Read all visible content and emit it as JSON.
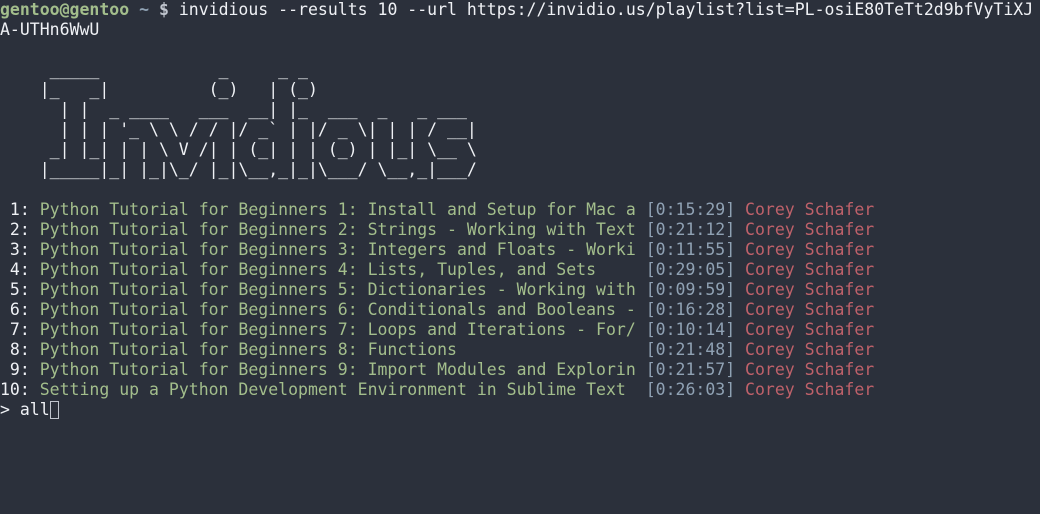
{
  "prompt": {
    "user_host": "gentoo@gentoo",
    "dir": "~",
    "symbol": "$",
    "command_line1": "invidious --results 10 --url https://invidio.us/playlist?list=PL-osiE80TeTt2d9bfVyTiXJ",
    "command_line2": "A-UTHn6WwU"
  },
  "banner": [
    "     _____            _     _ _",
    "    |_   _|          (_)   | (_)",
    "      | |  _ ____   ___  __| |_  ___  _   _ ___",
    "      | | | '_ \\ \\ / / |/ _` | |/ _ \\| | | / __|",
    "     _| |_| | | \\ V /| | (_| | | (_) | |_| \\__ \\",
    "    |_____|_| |_|\\_/ |_|\\__,_|_|\\___/ \\__,_|___/"
  ],
  "results": [
    {
      "index": " 1:",
      "title": " Python Tutorial for Beginners 1: Install and Setup for Mac a ",
      "duration": "[0:15:29]",
      "author": " Corey Schafer"
    },
    {
      "index": " 2:",
      "title": " Python Tutorial for Beginners 2: Strings - Working with Text ",
      "duration": "[0:21:12]",
      "author": " Corey Schafer"
    },
    {
      "index": " 3:",
      "title": " Python Tutorial for Beginners 3: Integers and Floats - Worki ",
      "duration": "[0:11:55]",
      "author": " Corey Schafer"
    },
    {
      "index": " 4:",
      "title": " Python Tutorial for Beginners 4: Lists, Tuples, and Sets     ",
      "duration": "[0:29:05]",
      "author": " Corey Schafer"
    },
    {
      "index": " 5:",
      "title": " Python Tutorial for Beginners 5: Dictionaries - Working with ",
      "duration": "[0:09:59]",
      "author": " Corey Schafer"
    },
    {
      "index": " 6:",
      "title": " Python Tutorial for Beginners 6: Conditionals and Booleans - ",
      "duration": "[0:16:28]",
      "author": " Corey Schafer"
    },
    {
      "index": " 7:",
      "title": " Python Tutorial for Beginners 7: Loops and Iterations - For/ ",
      "duration": "[0:10:14]",
      "author": " Corey Schafer"
    },
    {
      "index": " 8:",
      "title": " Python Tutorial for Beginners 8: Functions                   ",
      "duration": "[0:21:48]",
      "author": " Corey Schafer"
    },
    {
      "index": " 9:",
      "title": " Python Tutorial for Beginners 9: Import Modules and Explorin ",
      "duration": "[0:21:57]",
      "author": " Corey Schafer"
    },
    {
      "index": "10:",
      "title": " Setting up a Python Development Environment in Sublime Text  ",
      "duration": "[0:26:03]",
      "author": " Corey Schafer"
    }
  ],
  "input": {
    "prompt": "> ",
    "value": "all"
  },
  "colors": {
    "background": "#2b303b",
    "title": "#a3be8c",
    "duration": "#8fa1b3",
    "author": "#bf616a"
  }
}
